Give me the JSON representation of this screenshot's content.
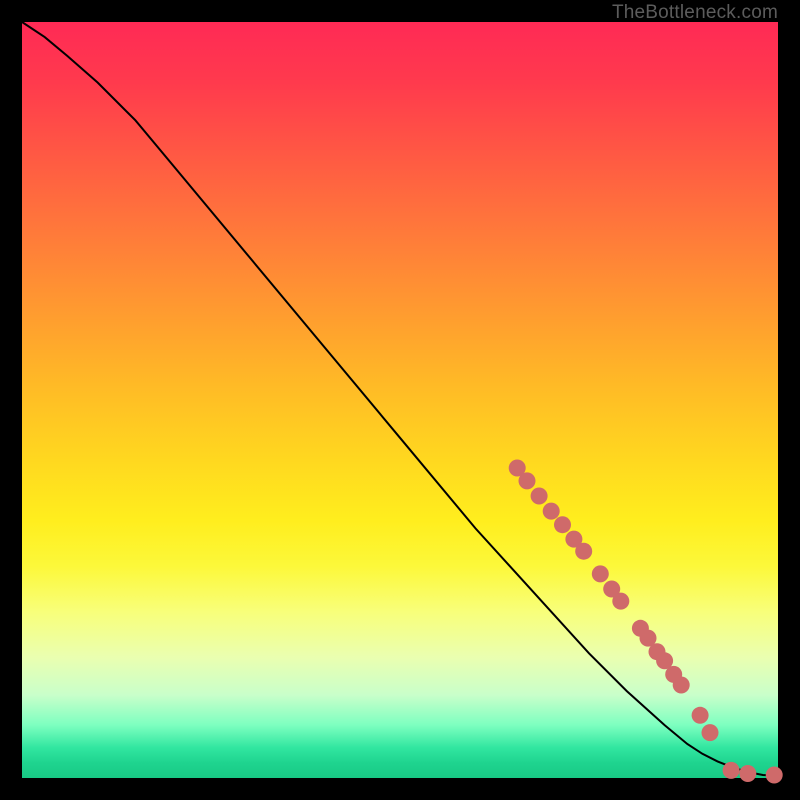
{
  "watermark": "TheBottleneck.com",
  "colors": {
    "marker": "#cf6a6a",
    "curve": "#000000",
    "frame": "#000000"
  },
  "chart_data": {
    "type": "line",
    "title": "",
    "xlabel": "",
    "ylabel": "",
    "xlim": [
      0,
      100
    ],
    "ylim": [
      0,
      100
    ],
    "series": [
      {
        "name": "curve",
        "x": [
          0,
          3,
          6,
          10,
          15,
          20,
          30,
          40,
          50,
          60,
          65,
          70,
          75,
          80,
          85,
          88,
          90,
          92,
          94,
          96,
          98,
          100
        ],
        "y": [
          100,
          98,
          95.5,
          92,
          87,
          81,
          69,
          57,
          45,
          33,
          27.5,
          22,
          16.5,
          11.5,
          7,
          4.5,
          3.2,
          2.2,
          1.4,
          0.8,
          0.4,
          0.3
        ]
      }
    ],
    "markers": [
      {
        "x": 65.5,
        "y": 41.0
      },
      {
        "x": 66.8,
        "y": 39.3
      },
      {
        "x": 68.4,
        "y": 37.3
      },
      {
        "x": 70.0,
        "y": 35.3
      },
      {
        "x": 71.5,
        "y": 33.5
      },
      {
        "x": 73.0,
        "y": 31.6
      },
      {
        "x": 74.3,
        "y": 30.0
      },
      {
        "x": 76.5,
        "y": 27.0
      },
      {
        "x": 78.0,
        "y": 25.0
      },
      {
        "x": 79.2,
        "y": 23.4
      },
      {
        "x": 81.8,
        "y": 19.8
      },
      {
        "x": 82.8,
        "y": 18.5
      },
      {
        "x": 84.0,
        "y": 16.7
      },
      {
        "x": 85.0,
        "y": 15.5
      },
      {
        "x": 86.2,
        "y": 13.7
      },
      {
        "x": 87.2,
        "y": 12.3
      },
      {
        "x": 89.7,
        "y": 8.3
      },
      {
        "x": 91.0,
        "y": 6.0
      },
      {
        "x": 93.8,
        "y": 1.0
      },
      {
        "x": 96.0,
        "y": 0.6
      },
      {
        "x": 99.5,
        "y": 0.4
      }
    ]
  }
}
